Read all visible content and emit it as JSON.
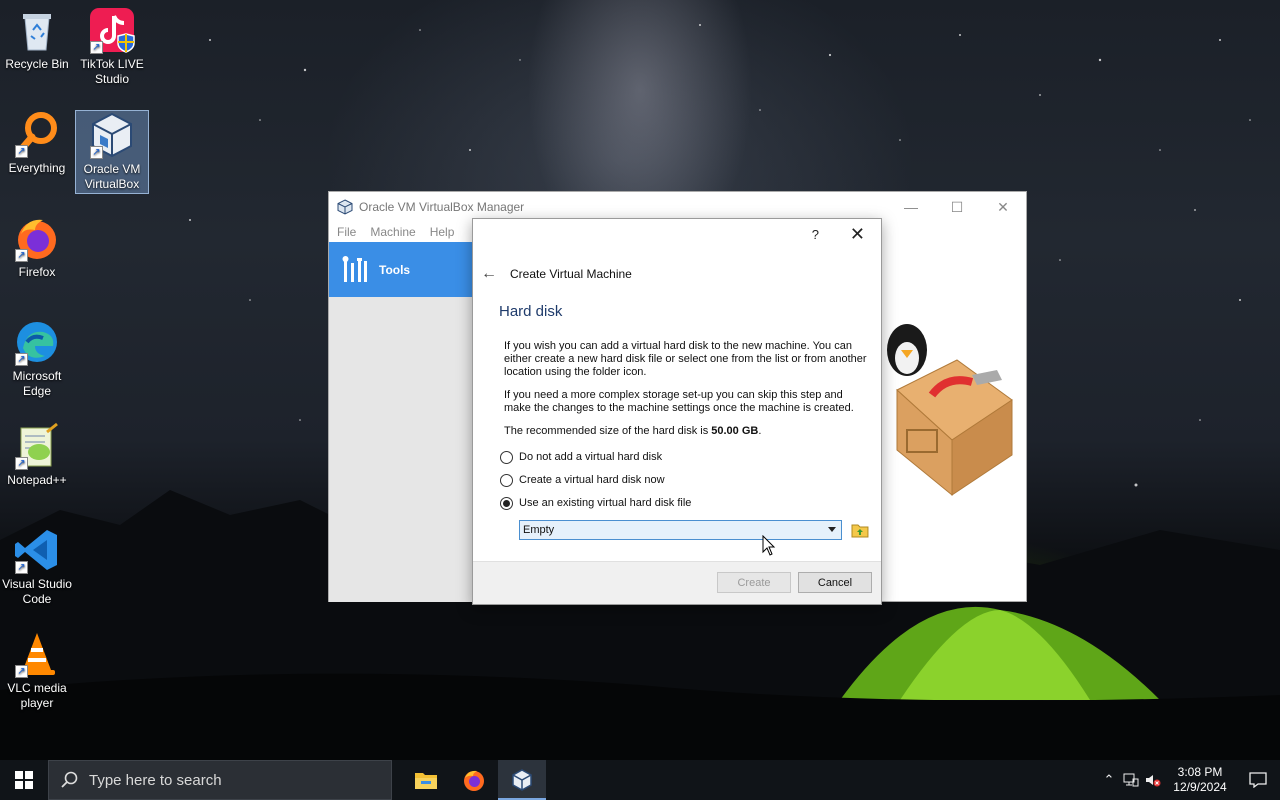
{
  "desktop": {
    "icons": [
      {
        "label": "Recycle Bin",
        "icon": "recycle-bin-icon"
      },
      {
        "label": "TikTok LIVE Studio",
        "icon": "tiktok-live-icon"
      },
      {
        "label": "Everything",
        "icon": "everything-search-icon"
      },
      {
        "label": "Oracle VM VirtualBox",
        "icon": "virtualbox-icon"
      },
      {
        "label": "Firefox",
        "icon": "firefox-icon"
      },
      {
        "label": "Microsoft Edge",
        "icon": "edge-icon"
      },
      {
        "label": "Notepad++",
        "icon": "notepadpp-icon"
      },
      {
        "label": "Visual Studio Code",
        "icon": "vscode-icon"
      },
      {
        "label": "VLC media player",
        "icon": "vlc-icon"
      }
    ]
  },
  "vbox_manager": {
    "title": "Oracle VM VirtualBox Manager",
    "menu": [
      "File",
      "Machine",
      "Help"
    ],
    "sidebar_tools_label": "Tools"
  },
  "dialog": {
    "help_label": "?",
    "nav_title": "Create Virtual Machine",
    "heading": "Hard disk",
    "para1": "If you wish you can add a virtual hard disk to the new machine. You can either create a new hard disk file or select one from the list or from another location using the folder icon.",
    "para2": "If you need a more complex storage set-up you can skip this step and make the changes to the machine settings once the machine is created.",
    "recommended_prefix": "The recommended size of the hard disk is ",
    "recommended_size": "50.00 GB",
    "recommended_suffix": ".",
    "options": [
      {
        "label": "Do not add a virtual hard disk",
        "checked": false
      },
      {
        "label": "Create a virtual hard disk now",
        "checked": false
      },
      {
        "label": "Use an existing virtual hard disk file",
        "checked": true
      }
    ],
    "disk_select_value": "Empty",
    "create_button": "Create",
    "cancel_button": "Cancel"
  },
  "taskbar": {
    "search_placeholder": "Type here to search",
    "time": "3:08 PM",
    "date": "12/9/2024"
  },
  "colors": {
    "accent_blue": "#3a8ee6",
    "heading_blue": "#1f3b6b",
    "taskbar": "#101418"
  }
}
